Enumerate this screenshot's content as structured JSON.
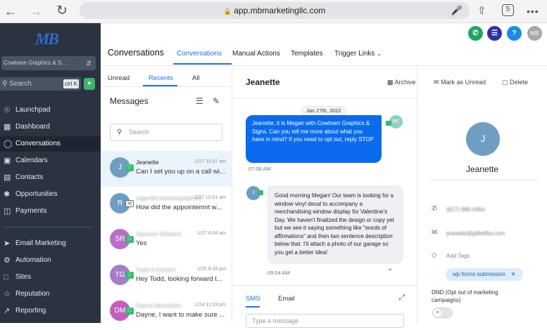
{
  "browser": {
    "url": "app.mbmarketingllc.com",
    "tab_count": "5",
    "back_icon": "arrow-left-icon",
    "forward_icon": "arrow-right-icon",
    "reload_icon": "reload-icon",
    "share_icon": "share-icon",
    "more_icon": "more-icon"
  },
  "sidebar": {
    "logo": "MB",
    "account": "Cowtown Graphics & S...",
    "search_placeholder": "Search",
    "search_shortcut": "ctrl K",
    "items": [
      {
        "label": "Launchpad",
        "icon": "launchpad-icon"
      },
      {
        "label": "Dashboard",
        "icon": "dashboard-icon"
      },
      {
        "label": "Conversations",
        "icon": "chat-icon"
      },
      {
        "label": "Calendars",
        "icon": "calendar-icon"
      },
      {
        "label": "Contacts",
        "icon": "contacts-icon"
      },
      {
        "label": "Opportunities",
        "icon": "opportunities-icon"
      },
      {
        "label": "Payments",
        "icon": "payments-icon"
      },
      {
        "label": "Email Marketing",
        "icon": "send-icon"
      },
      {
        "label": "Automation",
        "icon": "automation-icon"
      },
      {
        "label": "Sites",
        "icon": "sites-icon"
      },
      {
        "label": "Reputation",
        "icon": "star-icon"
      },
      {
        "label": "Reporting",
        "icon": "reporting-icon"
      }
    ]
  },
  "topbar": {
    "user_initials": "MB",
    "help": "?"
  },
  "header": {
    "title": "Conversations",
    "tabs": [
      "Conversations",
      "Manual Actions",
      "Templates",
      "Trigger Links"
    ]
  },
  "list": {
    "filters": [
      "Unread",
      "Recents",
      "All"
    ],
    "title": "Messages",
    "search_placeholder": "Search",
    "conversations": [
      {
        "initials": "J",
        "name": "Jeanette",
        "time": "1/27 11:07 am",
        "preview": "Can I set you up on a call wi...",
        "color": "#6e9ec2",
        "badge": "sms"
      },
      {
        "initials": "R",
        "name": "roger@cowtowngraphics",
        "time": "1/27 10:01 am",
        "preview": "How did the appointemnt w...",
        "color": "#6e9ec2",
        "badge": "email"
      },
      {
        "initials": "SR",
        "name": "Spencer Richard...",
        "time": "1/27 8:04 am",
        "preview": "Yes",
        "color": "#b96fc7",
        "badge": "sms"
      },
      {
        "initials": "TG",
        "name": "Todd A Gordon",
        "time": "1/25 9:18 pm",
        "preview": "Hey Todd, looking forward t...",
        "color": "#a97cc9",
        "badge": "sms"
      },
      {
        "initials": "DM",
        "name": "Dayne Mcmahon",
        "time": "1/24 11:03 pm",
        "preview": "Dayne, I want to make sure ...",
        "color": "#c45fbd",
        "badge": "sms"
      }
    ]
  },
  "chat": {
    "contact": "Jeanette",
    "actions": [
      "Archive",
      "Mark as Unread",
      "Delete"
    ],
    "date": "Jan 27th, 2022",
    "outgoing": {
      "text": "Jeanette, it is Megan with Cowtown Graphics & Signs. Can you tell me more about what you have in mind? If you need to opt out, reply STOP",
      "time": "07:06 AM",
      "sender_initials": "RC"
    },
    "incoming": {
      "text": "Good morning Megan! Our team is looking for a window vinyl decal to accompany a merchandising window display for Valentine's Day. We haven't finalized the design or copy yet but we see it saying something like \"words of affirmations\" and then two sentence description below that. I'll attach a photo of our garage so you get a better idea!",
      "time": "09:04 AM",
      "sender_initials": "J"
    },
    "composer_tabs": [
      "SMS",
      "Email"
    ],
    "composer_placeholder": "Type a message"
  },
  "profile": {
    "initials": "J",
    "name": "Jeanette",
    "phone": "(817) 986-4364",
    "email": "jeanette@giftedftw.com",
    "add_tags": "Add Tags",
    "tag": "wp forms submission",
    "dnd_label": "DND (Opt out of marketing campaigns)"
  },
  "colors": {
    "sidebar_bg": "#2b3341",
    "accent": "#1a73e8",
    "bubble_out": "#0b6bef",
    "phone_btn": "#1fa463",
    "tasks_btn": "#2f2fa8"
  }
}
